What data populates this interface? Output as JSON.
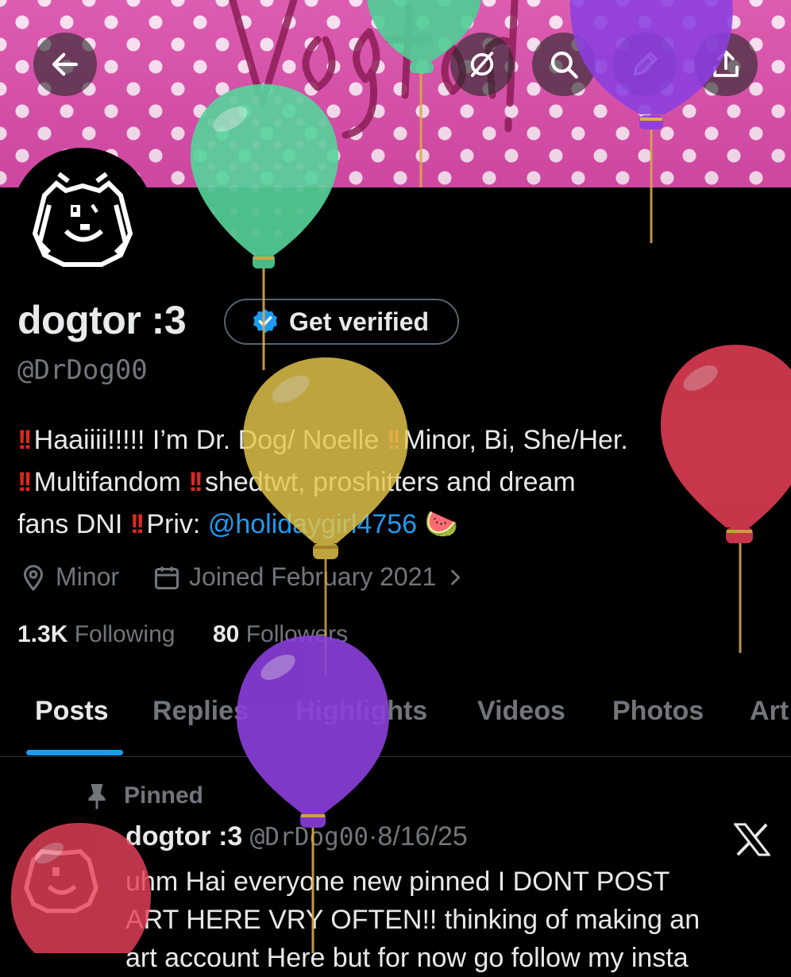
{
  "header": {
    "back_icon": "arrow-left-icon",
    "actions": [
      "grok-icon",
      "search-icon",
      "edit-pen-icon",
      "share-icon"
    ],
    "banner_text": "Vogtor!"
  },
  "profile": {
    "display_name": "dogtor :3",
    "verify_button": "Get verified",
    "handle": "@DrDog00",
    "bio": {
      "line1_text": "Haaiiii!!!!! I’m Dr. Dog/ Noelle",
      "line1_rest": "Minor, Bi, She/Her.",
      "line2_text": "Multifandom",
      "line2_rest": "shedtwt, proshitters and dream",
      "line3_text": "fans DNI",
      "line3_priv": "Priv:",
      "priv_link": "@holidaygirl4756",
      "emoji": "🍉"
    },
    "location": "Minor",
    "joined": "Joined February 2021",
    "following_count": "1.3K",
    "following_label": "Following",
    "followers_count": "80",
    "followers_label": "Followers"
  },
  "tabs": [
    "Posts",
    "Replies",
    "Highlights",
    "Videos",
    "Photos",
    "Art"
  ],
  "post": {
    "pinned_label": "Pinned",
    "author": "dogtor :3",
    "handle": "@DrDog00",
    "separator": "·",
    "date": "8/16/25",
    "line1": "uhm Hai everyone new pinned I DONT POST",
    "line2": "ART HERE VRY OFTEN!! thinking of making an",
    "line3": "art account Here but for now go follow my insta"
  },
  "colors": {
    "accent": "#1d9bf0",
    "banner_pink": "#d84aa8",
    "secondary_text": "#71767b",
    "alert_red": "#e0261e"
  }
}
